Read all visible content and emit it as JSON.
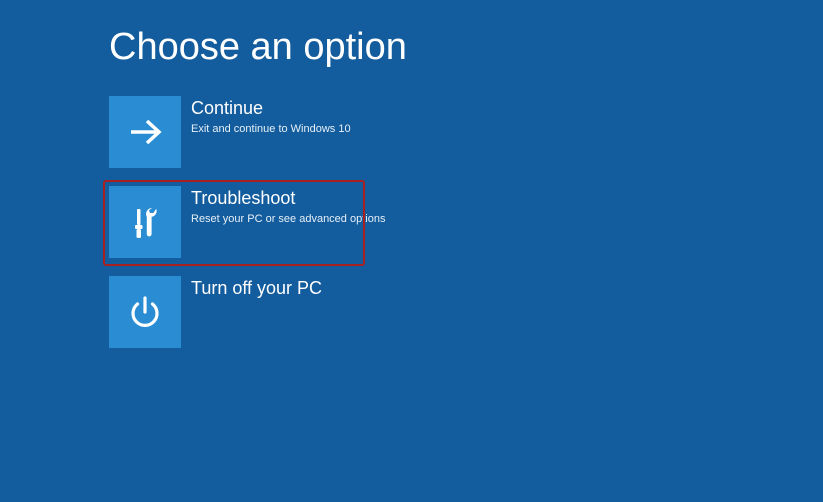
{
  "page_title": "Choose an option",
  "options": [
    {
      "title": "Continue",
      "description": "Exit and continue to Windows 10",
      "icon": "arrow-right-icon",
      "highlighted": false
    },
    {
      "title": "Troubleshoot",
      "description": "Reset your PC or see advanced options",
      "icon": "tools-icon",
      "highlighted": true
    },
    {
      "title": "Turn off your PC",
      "description": "",
      "icon": "power-icon",
      "highlighted": false
    }
  ],
  "colors": {
    "background": "#135c9d",
    "tile": "#2a8dd4",
    "highlight_border": "#a82020",
    "text": "#ffffff"
  }
}
